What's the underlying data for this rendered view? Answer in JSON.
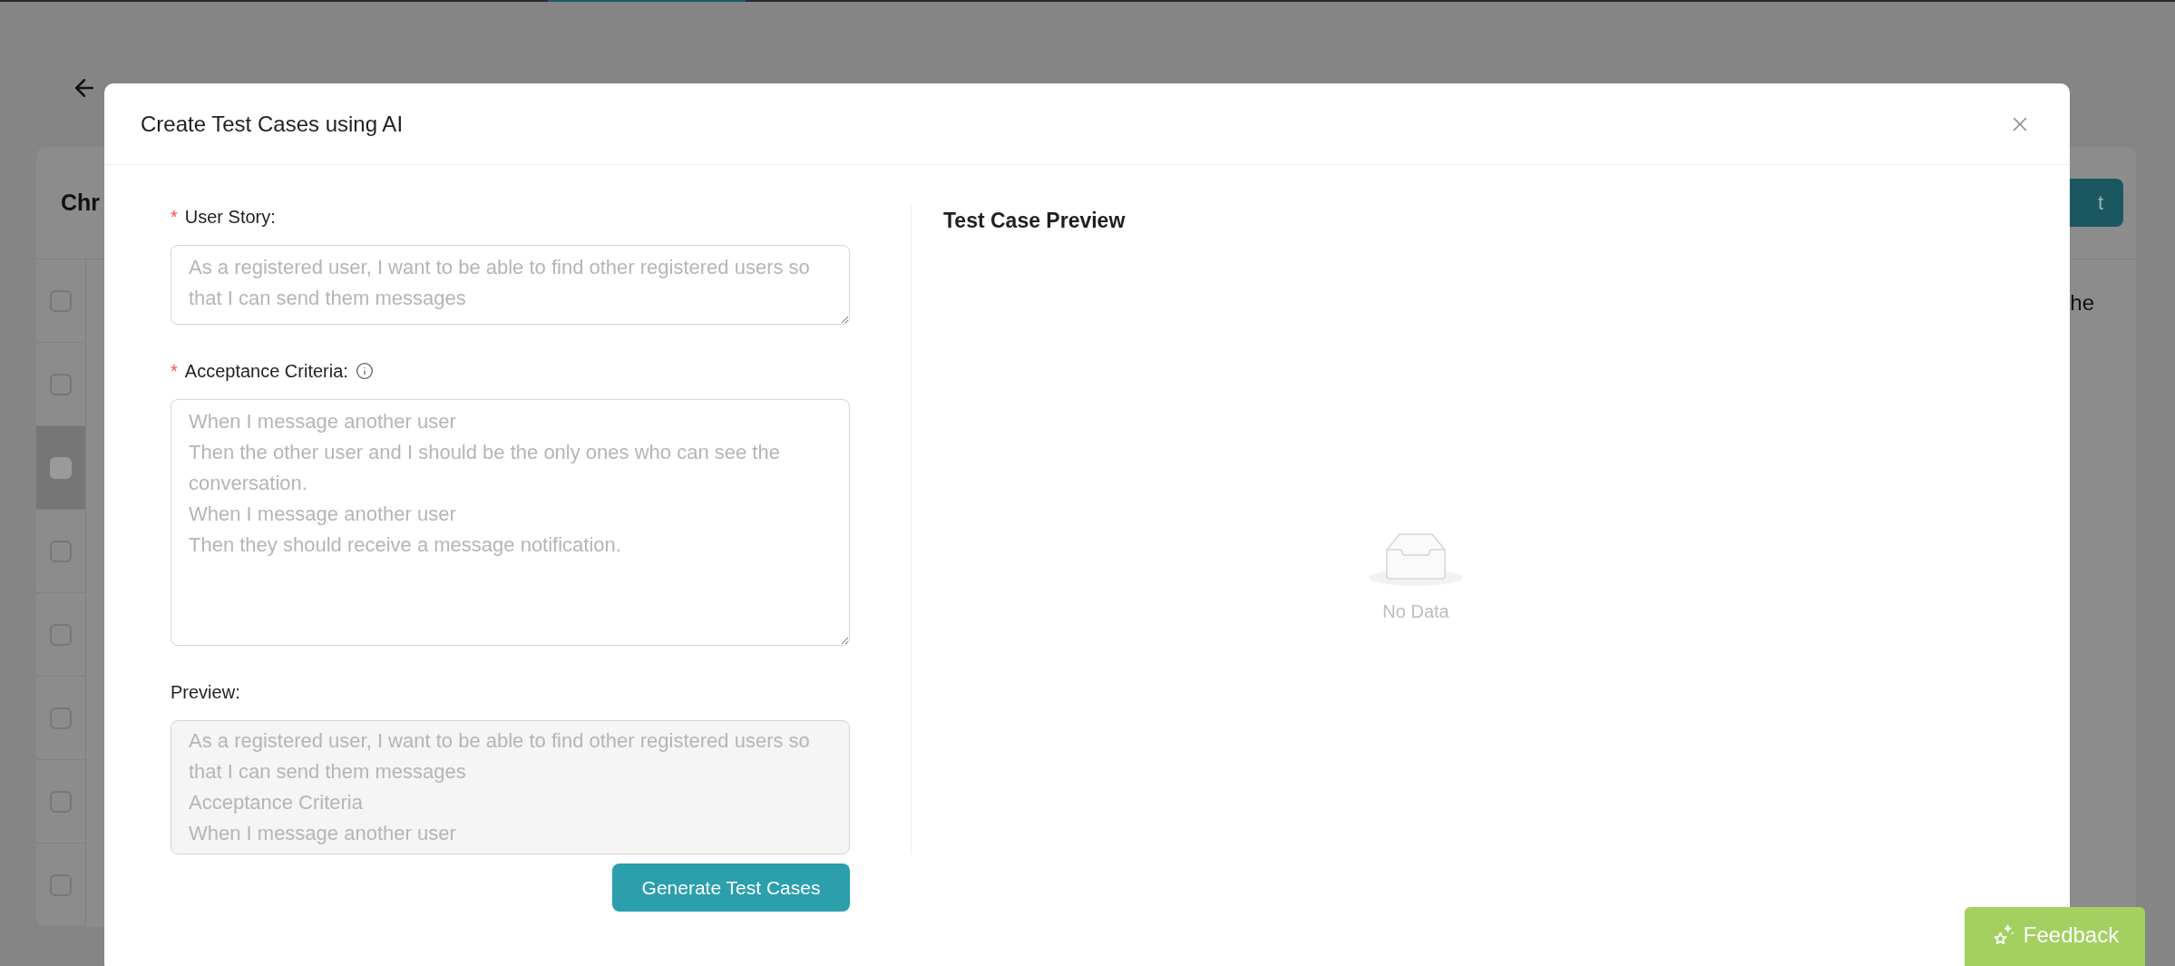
{
  "background": {
    "card_title": "Chr",
    "button_label": "t",
    "cell_text": "he",
    "rows": [
      {
        "selected": false
      },
      {
        "selected": false
      },
      {
        "selected": true
      },
      {
        "selected": false
      },
      {
        "selected": false
      },
      {
        "selected": false
      },
      {
        "selected": false
      },
      {
        "selected": false
      }
    ]
  },
  "modal": {
    "title": "Create Test Cases using AI",
    "fields": [
      {
        "label": "User Story:",
        "required_mark": "*",
        "info": false,
        "placeholder": "As a registered user, I want to be able to find other registered users so that I can send them messages"
      },
      {
        "label": "Acceptance Criteria:",
        "required_mark": "*",
        "info": true,
        "placeholder": "When I message another user\nThen the other user and I should be the only ones who can see the conversation.\nWhen I message another user\nThen they should receive a message notification."
      }
    ],
    "preview": {
      "label": "Preview:",
      "text": "As a registered user, I want to be able to find other registered users so that I can send them messages\nAcceptance Criteria\nWhen I message another user"
    },
    "generate_button": "Generate Test Cases",
    "right_panel": {
      "title": "Test Case Preview",
      "empty_text": "No Data"
    }
  },
  "feedback_button": "Feedback"
}
